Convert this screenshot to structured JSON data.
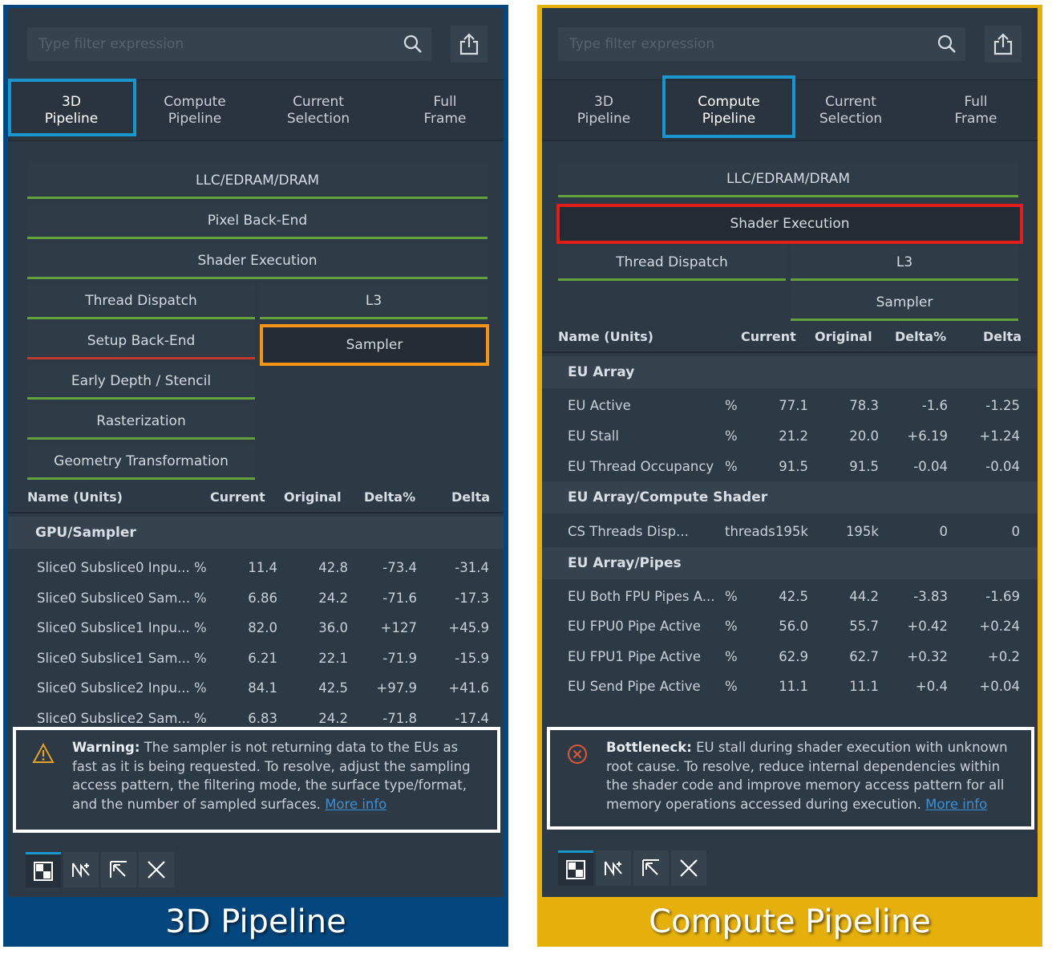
{
  "panels": [
    {
      "footer_title": "3D Pipeline",
      "filter_placeholder": "Type filter expression",
      "tabs": [
        {
          "label": "3D\nPipeline"
        },
        {
          "label": "Compute\nPipeline"
        },
        {
          "label": "Current\nSelection"
        },
        {
          "label": "Full\nFrame"
        }
      ],
      "blocks": {
        "llc": "LLC/EDRAM/DRAM",
        "pixel_backend": "Pixel Back-End",
        "shader_execution": "Shader Execution",
        "thread_dispatch": "Thread Dispatch",
        "l3": "L3",
        "setup_backend": "Setup Back-End",
        "sampler": "Sampler",
        "early_depth": "Early Depth / Stencil",
        "rasterization": "Rasterization",
        "geometry": "Geometry Transformation"
      },
      "columns": [
        "Name (Units)",
        "Current",
        "Original",
        "Delta%",
        "Delta"
      ],
      "group": "GPU/Sampler",
      "rows": [
        {
          "name": "Slice0 Subslice0 Inpu...",
          "unit": "%",
          "current": "11.4",
          "original": "42.8",
          "delta_pct": "-73.4",
          "delta": "-31.4"
        },
        {
          "name": "Slice0 Subslice0 Sam...",
          "unit": "%",
          "current": "6.86",
          "original": "24.2",
          "delta_pct": "-71.6",
          "delta": "-17.3"
        },
        {
          "name": "Slice0 Subslice1 Inpu...",
          "unit": "%",
          "current": "82.0",
          "original": "36.0",
          "delta_pct": "+127",
          "delta": "+45.9"
        },
        {
          "name": "Slice0 Subslice1 Sam...",
          "unit": "%",
          "current": "6.21",
          "original": "22.1",
          "delta_pct": "-71.9",
          "delta": "-15.9"
        },
        {
          "name": "Slice0 Subslice2 Inpu...",
          "unit": "%",
          "current": "84.1",
          "original": "42.5",
          "delta_pct": "+97.9",
          "delta": "+41.6"
        },
        {
          "name": "Slice0 Subslice2 Sam...",
          "unit": "%",
          "current": "6.83",
          "original": "24.2",
          "delta_pct": "-71.8",
          "delta": "-17.4"
        }
      ],
      "message": {
        "lead": "Warning:",
        "body": "The sampler is not returning data to the EUs as fast as it is being requested. To resolve, adjust the sampling access pattern, the filtering mode, the surface type/format, and the number of sampled surfaces.",
        "link": "More info"
      }
    },
    {
      "footer_title": "Compute Pipeline",
      "filter_placeholder": "Type filter expression",
      "tabs": [
        {
          "label": "3D\nPipeline"
        },
        {
          "label": "Compute\nPipeline"
        },
        {
          "label": "Current\nSelection"
        },
        {
          "label": "Full\nFrame"
        }
      ],
      "blocks": {
        "llc": "LLC/EDRAM/DRAM",
        "shader_execution": "Shader Execution",
        "thread_dispatch": "Thread Dispatch",
        "l3": "L3",
        "sampler": "Sampler"
      },
      "columns": [
        "Name (Units)",
        "Current",
        "Original",
        "Delta%",
        "Delta"
      ],
      "groups": [
        {
          "title": "EU Array",
          "rows": [
            {
              "name": "EU Active",
              "unit": "%",
              "current": "77.1",
              "original": "78.3",
              "delta_pct": "-1.6",
              "delta": "-1.25"
            },
            {
              "name": "EU Stall",
              "unit": "%",
              "current": "21.2",
              "original": "20.0",
              "delta_pct": "+6.19",
              "delta": "+1.24"
            },
            {
              "name": "EU Thread Occupancy",
              "unit": "%",
              "current": "91.5",
              "original": "91.5",
              "delta_pct": "-0.04",
              "delta": "-0.04"
            }
          ]
        },
        {
          "title": "EU Array/Compute Shader",
          "rows": [
            {
              "name": "CS Threads Disp...",
              "unit": "threads",
              "current": "195k",
              "original": "195k",
              "delta_pct": "0",
              "delta": "0"
            }
          ]
        },
        {
          "title": "EU Array/Pipes",
          "rows": [
            {
              "name": "EU Both FPU Pipes A...",
              "unit": "%",
              "current": "42.5",
              "original": "44.2",
              "delta_pct": "-3.83",
              "delta": "-1.69"
            },
            {
              "name": "EU FPU0 Pipe Active",
              "unit": "%",
              "current": "56.0",
              "original": "55.7",
              "delta_pct": "+0.42",
              "delta": "+0.24"
            },
            {
              "name": "EU FPU1 Pipe Active",
              "unit": "%",
              "current": "62.9",
              "original": "62.7",
              "delta_pct": "+0.32",
              "delta": "+0.2"
            },
            {
              "name": "EU Send Pipe Active",
              "unit": "%",
              "current": "11.1",
              "original": "11.1",
              "delta_pct": "+0.4",
              "delta": "+0.04"
            }
          ]
        }
      ],
      "message": {
        "lead": "Bottleneck:",
        "body": "EU stall during shader execution with unknown root cause. To resolve, reduce internal dependencies within the shader code and improve memory access pattern for all memory operations accessed during execution.",
        "link": "More info"
      }
    }
  ],
  "icons": {
    "search": "search-icon",
    "share": "share-icon",
    "warning": "warning-icon",
    "bottleneck": "error-circle-icon",
    "toolbar": [
      "grid-view-icon",
      "pipeline-flow-icon",
      "arrow-up-left-icon",
      "close-icon"
    ]
  },
  "colors": {
    "frame_left": "#04477f",
    "frame_right": "#e6b00c",
    "panel_bg": "#2d3944",
    "active_tab_outline": "#1a96cf",
    "ok_underline": "#62a23c",
    "bad_underline": "#c0392b",
    "sampler_highlight": "#f39419",
    "shader_highlight": "#e21b1b",
    "link": "#3d8fd6"
  }
}
